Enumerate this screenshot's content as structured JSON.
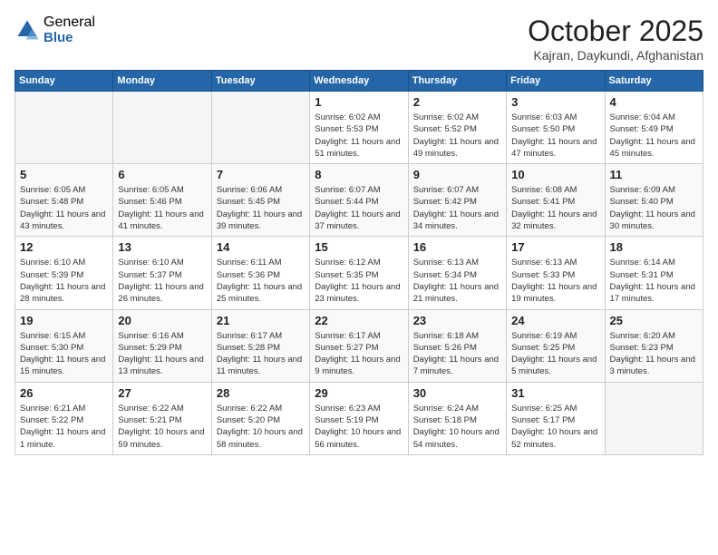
{
  "logo": {
    "general": "General",
    "blue": "Blue"
  },
  "header": {
    "month": "October 2025",
    "location": "Kajran, Daykundi, Afghanistan"
  },
  "weekdays": [
    "Sunday",
    "Monday",
    "Tuesday",
    "Wednesday",
    "Thursday",
    "Friday",
    "Saturday"
  ],
  "weeks": [
    [
      {
        "day": "",
        "sunrise": "",
        "sunset": "",
        "daylight": "",
        "empty": true
      },
      {
        "day": "",
        "sunrise": "",
        "sunset": "",
        "daylight": "",
        "empty": true
      },
      {
        "day": "",
        "sunrise": "",
        "sunset": "",
        "daylight": "",
        "empty": true
      },
      {
        "day": "1",
        "sunrise": "Sunrise: 6:02 AM",
        "sunset": "Sunset: 5:53 PM",
        "daylight": "Daylight: 11 hours and 51 minutes.",
        "empty": false
      },
      {
        "day": "2",
        "sunrise": "Sunrise: 6:02 AM",
        "sunset": "Sunset: 5:52 PM",
        "daylight": "Daylight: 11 hours and 49 minutes.",
        "empty": false
      },
      {
        "day": "3",
        "sunrise": "Sunrise: 6:03 AM",
        "sunset": "Sunset: 5:50 PM",
        "daylight": "Daylight: 11 hours and 47 minutes.",
        "empty": false
      },
      {
        "day": "4",
        "sunrise": "Sunrise: 6:04 AM",
        "sunset": "Sunset: 5:49 PM",
        "daylight": "Daylight: 11 hours and 45 minutes.",
        "empty": false
      }
    ],
    [
      {
        "day": "5",
        "sunrise": "Sunrise: 6:05 AM",
        "sunset": "Sunset: 5:48 PM",
        "daylight": "Daylight: 11 hours and 43 minutes.",
        "empty": false
      },
      {
        "day": "6",
        "sunrise": "Sunrise: 6:05 AM",
        "sunset": "Sunset: 5:46 PM",
        "daylight": "Daylight: 11 hours and 41 minutes.",
        "empty": false
      },
      {
        "day": "7",
        "sunrise": "Sunrise: 6:06 AM",
        "sunset": "Sunset: 5:45 PM",
        "daylight": "Daylight: 11 hours and 39 minutes.",
        "empty": false
      },
      {
        "day": "8",
        "sunrise": "Sunrise: 6:07 AM",
        "sunset": "Sunset: 5:44 PM",
        "daylight": "Daylight: 11 hours and 37 minutes.",
        "empty": false
      },
      {
        "day": "9",
        "sunrise": "Sunrise: 6:07 AM",
        "sunset": "Sunset: 5:42 PM",
        "daylight": "Daylight: 11 hours and 34 minutes.",
        "empty": false
      },
      {
        "day": "10",
        "sunrise": "Sunrise: 6:08 AM",
        "sunset": "Sunset: 5:41 PM",
        "daylight": "Daylight: 11 hours and 32 minutes.",
        "empty": false
      },
      {
        "day": "11",
        "sunrise": "Sunrise: 6:09 AM",
        "sunset": "Sunset: 5:40 PM",
        "daylight": "Daylight: 11 hours and 30 minutes.",
        "empty": false
      }
    ],
    [
      {
        "day": "12",
        "sunrise": "Sunrise: 6:10 AM",
        "sunset": "Sunset: 5:39 PM",
        "daylight": "Daylight: 11 hours and 28 minutes.",
        "empty": false
      },
      {
        "day": "13",
        "sunrise": "Sunrise: 6:10 AM",
        "sunset": "Sunset: 5:37 PM",
        "daylight": "Daylight: 11 hours and 26 minutes.",
        "empty": false
      },
      {
        "day": "14",
        "sunrise": "Sunrise: 6:11 AM",
        "sunset": "Sunset: 5:36 PM",
        "daylight": "Daylight: 11 hours and 25 minutes.",
        "empty": false
      },
      {
        "day": "15",
        "sunrise": "Sunrise: 6:12 AM",
        "sunset": "Sunset: 5:35 PM",
        "daylight": "Daylight: 11 hours and 23 minutes.",
        "empty": false
      },
      {
        "day": "16",
        "sunrise": "Sunrise: 6:13 AM",
        "sunset": "Sunset: 5:34 PM",
        "daylight": "Daylight: 11 hours and 21 minutes.",
        "empty": false
      },
      {
        "day": "17",
        "sunrise": "Sunrise: 6:13 AM",
        "sunset": "Sunset: 5:33 PM",
        "daylight": "Daylight: 11 hours and 19 minutes.",
        "empty": false
      },
      {
        "day": "18",
        "sunrise": "Sunrise: 6:14 AM",
        "sunset": "Sunset: 5:31 PM",
        "daylight": "Daylight: 11 hours and 17 minutes.",
        "empty": false
      }
    ],
    [
      {
        "day": "19",
        "sunrise": "Sunrise: 6:15 AM",
        "sunset": "Sunset: 5:30 PM",
        "daylight": "Daylight: 11 hours and 15 minutes.",
        "empty": false
      },
      {
        "day": "20",
        "sunrise": "Sunrise: 6:16 AM",
        "sunset": "Sunset: 5:29 PM",
        "daylight": "Daylight: 11 hours and 13 minutes.",
        "empty": false
      },
      {
        "day": "21",
        "sunrise": "Sunrise: 6:17 AM",
        "sunset": "Sunset: 5:28 PM",
        "daylight": "Daylight: 11 hours and 11 minutes.",
        "empty": false
      },
      {
        "day": "22",
        "sunrise": "Sunrise: 6:17 AM",
        "sunset": "Sunset: 5:27 PM",
        "daylight": "Daylight: 11 hours and 9 minutes.",
        "empty": false
      },
      {
        "day": "23",
        "sunrise": "Sunrise: 6:18 AM",
        "sunset": "Sunset: 5:26 PM",
        "daylight": "Daylight: 11 hours and 7 minutes.",
        "empty": false
      },
      {
        "day": "24",
        "sunrise": "Sunrise: 6:19 AM",
        "sunset": "Sunset: 5:25 PM",
        "daylight": "Daylight: 11 hours and 5 minutes.",
        "empty": false
      },
      {
        "day": "25",
        "sunrise": "Sunrise: 6:20 AM",
        "sunset": "Sunset: 5:23 PM",
        "daylight": "Daylight: 11 hours and 3 minutes.",
        "empty": false
      }
    ],
    [
      {
        "day": "26",
        "sunrise": "Sunrise: 6:21 AM",
        "sunset": "Sunset: 5:22 PM",
        "daylight": "Daylight: 11 hours and 1 minute.",
        "empty": false
      },
      {
        "day": "27",
        "sunrise": "Sunrise: 6:22 AM",
        "sunset": "Sunset: 5:21 PM",
        "daylight": "Daylight: 10 hours and 59 minutes.",
        "empty": false
      },
      {
        "day": "28",
        "sunrise": "Sunrise: 6:22 AM",
        "sunset": "Sunset: 5:20 PM",
        "daylight": "Daylight: 10 hours and 58 minutes.",
        "empty": false
      },
      {
        "day": "29",
        "sunrise": "Sunrise: 6:23 AM",
        "sunset": "Sunset: 5:19 PM",
        "daylight": "Daylight: 10 hours and 56 minutes.",
        "empty": false
      },
      {
        "day": "30",
        "sunrise": "Sunrise: 6:24 AM",
        "sunset": "Sunset: 5:18 PM",
        "daylight": "Daylight: 10 hours and 54 minutes.",
        "empty": false
      },
      {
        "day": "31",
        "sunrise": "Sunrise: 6:25 AM",
        "sunset": "Sunset: 5:17 PM",
        "daylight": "Daylight: 10 hours and 52 minutes.",
        "empty": false
      },
      {
        "day": "",
        "sunrise": "",
        "sunset": "",
        "daylight": "",
        "empty": true
      }
    ]
  ]
}
